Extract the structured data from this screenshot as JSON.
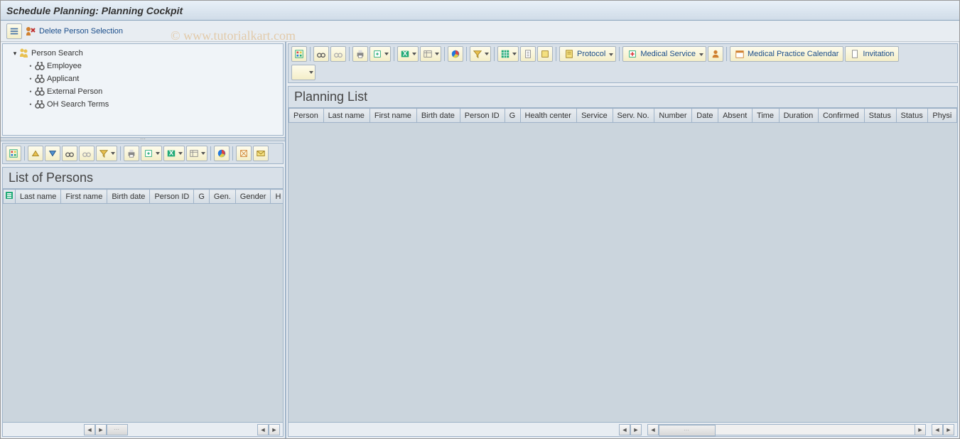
{
  "title": "Schedule Planning: Planning Cockpit",
  "watermark": "© www.tutorialkart.com",
  "actionbar": {
    "delete_label": "Delete Person Selection"
  },
  "tree": {
    "root": "Person Search",
    "items": [
      "Employee",
      "Applicant",
      "External Person",
      "OH Search Terms"
    ]
  },
  "left": {
    "heading": "List of Persons",
    "columns": [
      "Last name",
      "First name",
      "Birth date",
      "Person ID",
      "G",
      "Gen.",
      "Gender",
      "H"
    ]
  },
  "right": {
    "heading": "Planning List",
    "buttons": {
      "protocol": "Protocol",
      "medical_service": "Medical Service",
      "calendar": "Medical Practice Calendar",
      "invitation": "Invitation"
    },
    "columns": [
      "Person",
      "Last name",
      "First name",
      "Birth date",
      "Person ID",
      "G",
      "Health center",
      "Service",
      "Serv. No.",
      "Number",
      "Date",
      "Absent",
      "Time",
      "Duration",
      "Confirmed",
      "Status",
      "Status",
      "Physi"
    ]
  },
  "icons": {
    "details": "details-icon",
    "delete_sel": "delete-person-icon",
    "binoculars": "binoculars-icon",
    "binoculars_next": "binoculars-next-icon",
    "print": "print-icon",
    "export": "export-icon",
    "excel": "excel-icon",
    "layout": "layout-icon",
    "chart": "chart-icon",
    "filter": "filter-icon",
    "sort_asc": "sort-asc-icon",
    "sort_desc": "sort-desc-icon",
    "sum": "sum-icon",
    "subtotal": "subtotal-icon",
    "refresh": "refresh-icon",
    "select": "select-icon",
    "person": "person-icon",
    "calendar": "calendar-icon",
    "doc": "document-icon",
    "grid": "grid-icon",
    "mail": "mail-icon"
  }
}
